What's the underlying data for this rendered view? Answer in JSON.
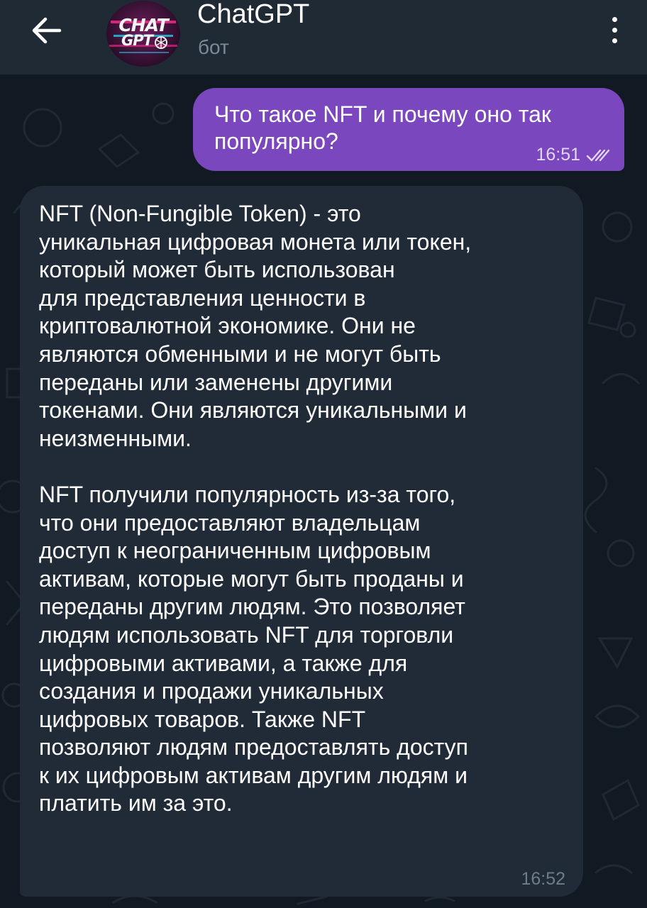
{
  "header": {
    "title": "ChatGPT",
    "subtitle": "бот",
    "avatar": {
      "line1": "CHAT",
      "line2": "GPT"
    }
  },
  "icons": {
    "back": "arrow-left-icon",
    "menu": "more-vertical-icon",
    "read_status": "double-check-icon"
  },
  "colors": {
    "header_bg": "#202a35",
    "outgoing_bubble": "#7b47bf",
    "incoming_bubble": "#212b37",
    "chat_bg": "#111a22"
  },
  "messages": {
    "outgoing": {
      "text": "Что такое NFT и почему оно так\nпопулярно?",
      "time": "16:51"
    },
    "incoming": {
      "paragraph1": "NFT (Non-Fungible Token) - это\nуникальная цифровая монета или токен,\nкоторый может быть использован\nдля представления ценности в\nкриптовалютной экономике. Они не\nявляются обменными и не могут быть\nпереданы или заменены другими\nтокенами. Они являются уникальными и\nнеизменными.",
      "paragraph2": "NFT получили популярность из-за того,\nчто они предоставляют владельцам\nдоступ к неограниченным цифровым\nактивам, которые могут быть проданы и\nпереданы другим людям. Это позволяет\nлюдям использовать NFT для торговли\nцифровыми активами, а также для\nсоздания и продажи уникальных\nцифровых товаров. Также NFT\nпозволяют людям предоставлять доступ\nк их цифровым активам другим людям и\nплатить им за это.",
      "time": "16:52"
    }
  }
}
